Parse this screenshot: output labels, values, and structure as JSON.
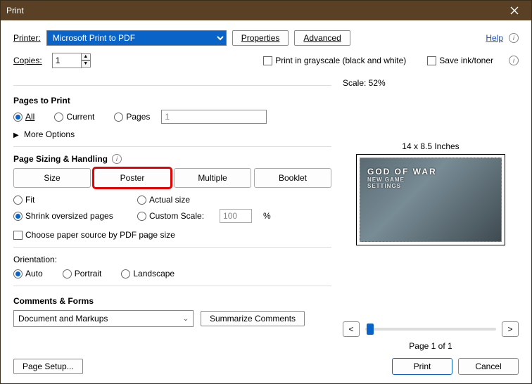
{
  "titlebar": {
    "title": "Print"
  },
  "header": {
    "printerLabel": "Printer:",
    "printerValue": "Microsoft Print to PDF",
    "propertiesBtn": "Properties",
    "advancedBtn": "Advanced",
    "helpLabel": "Help",
    "copiesLabel": "Copies:",
    "copiesValue": "1",
    "grayscaleLabel": "Print in grayscale (black and white)",
    "saveInkLabel": "Save ink/toner"
  },
  "pagesToPrint": {
    "heading": "Pages to Print",
    "all": "All",
    "current": "Current",
    "pages": "Pages",
    "pagesValue": "1",
    "moreOptions": "More Options"
  },
  "sizing": {
    "heading": "Page Sizing & Handling",
    "tabs": {
      "size": "Size",
      "poster": "Poster",
      "multiple": "Multiple",
      "booklet": "Booklet"
    },
    "fit": "Fit",
    "actual": "Actual size",
    "shrink": "Shrink oversized pages",
    "custom": "Custom Scale:",
    "customValue": "100",
    "percent": "%",
    "choosePaper": "Choose paper source by PDF page size"
  },
  "orientation": {
    "heading": "Orientation:",
    "auto": "Auto",
    "portrait": "Portrait",
    "landscape": "Landscape"
  },
  "comments": {
    "heading": "Comments & Forms",
    "comboValue": "Document and Markups",
    "summarizeBtn": "Summarize Comments"
  },
  "preview": {
    "scaleLabel": "Scale:  52%",
    "dimensions": "14 x 8.5 Inches",
    "contentTitle": "GOD OF WAR",
    "contentSub1": "NEW GAME",
    "contentSub2": "SETTINGS",
    "prev": "<",
    "next": ">",
    "pageLabel": "Page 1 of 1"
  },
  "footer": {
    "pageSetup": "Page Setup...",
    "print": "Print",
    "cancel": "Cancel"
  }
}
